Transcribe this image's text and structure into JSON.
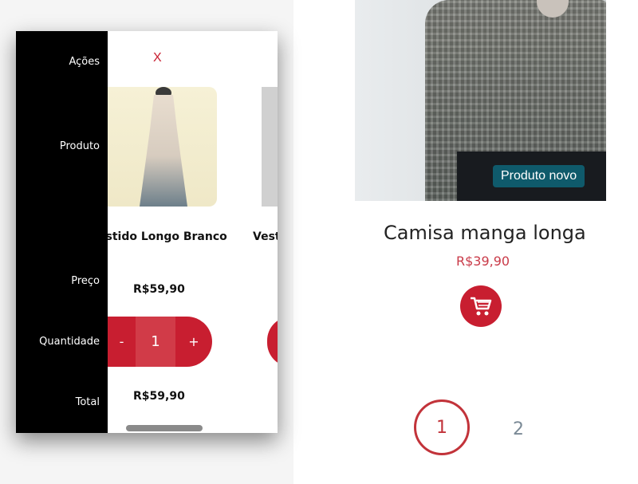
{
  "product_card": {
    "badge": "Produto novo",
    "title": "Camisa manga longa",
    "price": "R$39,90",
    "cart_icon": "shopping-cart-icon"
  },
  "pagination": {
    "current": "1",
    "next": "2"
  },
  "cart": {
    "labels": {
      "actions": "Ações",
      "product": "Produto",
      "price": "Preço",
      "quantity": "Quantidade",
      "total": "Total"
    },
    "remove_label": "X",
    "items": [
      {
        "name": "estido Longo Branco",
        "price": "R$59,90",
        "quantity": "1",
        "total": "R$59,90",
        "minus": "-",
        "plus": "+"
      },
      {
        "name": "Vest"
      }
    ]
  },
  "colors": {
    "accent": "#c81e30",
    "badge": "#0f5a6b",
    "price": "#c93a48",
    "panel_labels_bg": "#000000"
  }
}
